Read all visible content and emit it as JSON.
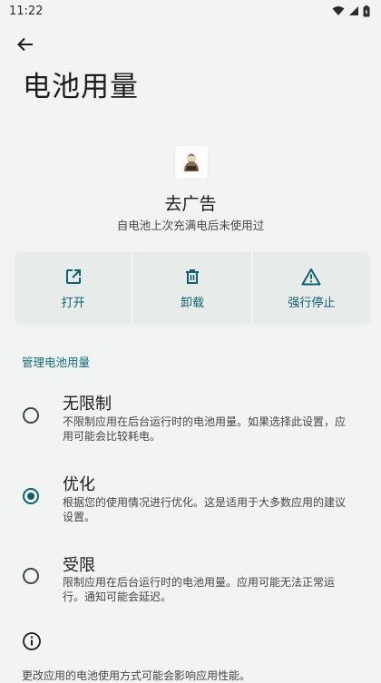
{
  "status_bar": {
    "time": "11:22"
  },
  "page": {
    "title": "电池用量"
  },
  "app": {
    "name": "去广告",
    "summary": "自电池上次充满电后未使用过"
  },
  "actions": [
    {
      "label": "打开",
      "icon": "open-external-icon"
    },
    {
      "label": "卸载",
      "icon": "trash-icon"
    },
    {
      "label": "强行停止",
      "icon": "warning-icon"
    }
  ],
  "section": {
    "header": "管理电池用量"
  },
  "options": [
    {
      "title": "无限制",
      "description": "不限制应用在后台运行时的电池用量。如果选择此设置，应用可能会比较耗电。",
      "selected": false
    },
    {
      "title": "优化",
      "description": "根据您的使用情况进行优化。这是适用于大多数应用的建议设置。",
      "selected": true
    },
    {
      "title": "受限",
      "description": "限制应用在后台运行时的电池用量。应用可能无法正常运行。通知可能会延迟。",
      "selected": false
    }
  ],
  "footer": {
    "text": "更改应用的电池使用方式可能会影响应用性能。"
  },
  "colors": {
    "accent": "#0c6270",
    "background": "#f1f4f3",
    "action_bg": "#e7ebea"
  }
}
